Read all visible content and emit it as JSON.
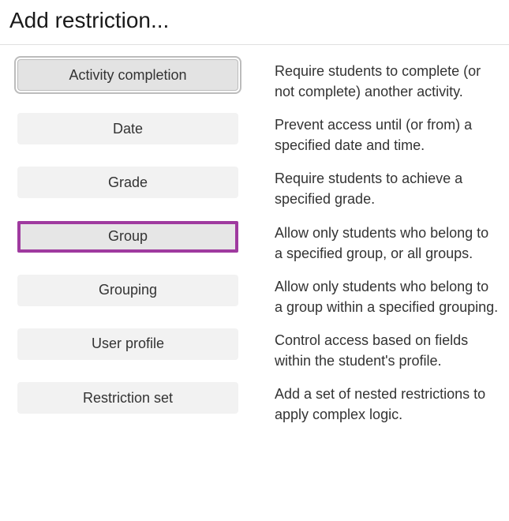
{
  "dialog": {
    "title": "Add restriction..."
  },
  "restrictions": [
    {
      "label": "Activity completion",
      "description": "Require students to complete (or not complete) another activity.",
      "state": "focused"
    },
    {
      "label": "Date",
      "description": "Prevent access until (or from) a specified date and time.",
      "state": "normal"
    },
    {
      "label": "Grade",
      "description": "Require students to achieve a specified grade.",
      "state": "normal"
    },
    {
      "label": "Group",
      "description": "Allow only students who belong to a specified group, or all groups.",
      "state": "highlighted"
    },
    {
      "label": "Grouping",
      "description": "Allow only students who belong to a group within a specified grouping.",
      "state": "normal"
    },
    {
      "label": "User profile",
      "description": "Control access based on fields within the student's profile.",
      "state": "normal"
    },
    {
      "label": "Restriction set",
      "description": "Add a set of nested restrictions to apply complex logic.",
      "state": "normal"
    }
  ]
}
